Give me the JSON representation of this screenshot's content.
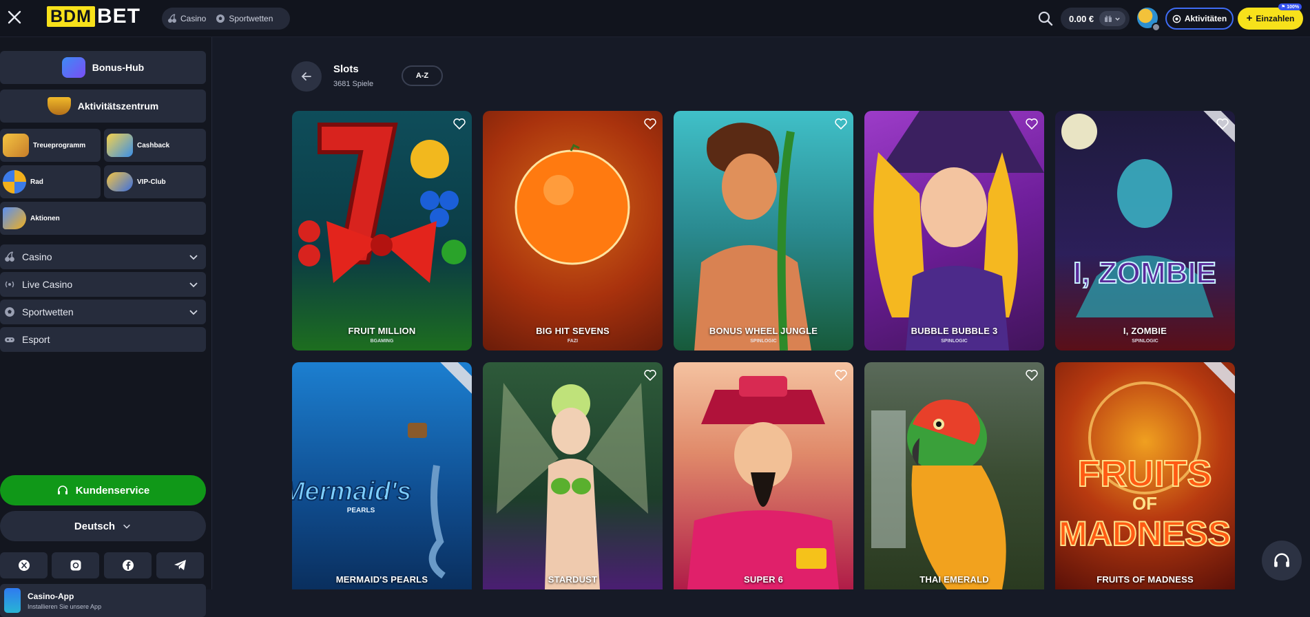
{
  "header": {
    "logo_left": "BDM",
    "logo_right": "BET",
    "nav": [
      {
        "label": "Casino",
        "icon": "casino-icon"
      },
      {
        "label": "Sportwetten",
        "icon": "soccer-ball-icon"
      }
    ],
    "balance": "0.00 €",
    "activities_label": "Aktivitäten",
    "deposit_label": "Einzahlen",
    "deposit_badge": "100%"
  },
  "sidebar": {
    "bonus_hub": "Bonus-Hub",
    "activity_center": "Aktivitätszentrum",
    "grid": [
      {
        "label": "Treueprogramm",
        "icon": "treasure-chest-icon"
      },
      {
        "label": "Cashback",
        "icon": "coin-stack-icon"
      },
      {
        "label": "Rad",
        "icon": "wheel-icon"
      },
      {
        "label": "VIP-Club",
        "icon": "vip-icon"
      },
      {
        "label": "Aktionen",
        "icon": "megaphone-icon"
      }
    ],
    "nav": [
      {
        "label": "Casino",
        "icon": "cherries-icon",
        "expandable": true
      },
      {
        "label": "Live Casino",
        "icon": "broadcast-icon",
        "expandable": true
      },
      {
        "label": "Sportwetten",
        "icon": "soccer-ball-icon",
        "expandable": true
      },
      {
        "label": "Esport",
        "icon": "gamepad-icon",
        "expandable": false
      }
    ],
    "support": "Kundenservice",
    "language": "Deutsch",
    "socials": [
      "x-icon",
      "instagram-icon",
      "facebook-icon",
      "telegram-icon"
    ],
    "app": {
      "title": "Casino-App",
      "subtitle": "Installieren Sie unsere App"
    }
  },
  "page": {
    "title": "Slots",
    "count": "3681 Spiele",
    "sort_label": "A-Z"
  },
  "games": [
    {
      "name": "FRUIT MILLION",
      "provider": "BGAMING"
    },
    {
      "name": "BIG HIT SEVENS",
      "provider": "FAZI"
    },
    {
      "name": "BONUS WHEEL JUNGLE",
      "provider": "SPINLOGIC"
    },
    {
      "name": "BUBBLE BUBBLE 3",
      "provider": "SPINLOGIC"
    },
    {
      "name": "I, ZOMBIE",
      "provider": "SPINLOGIC"
    },
    {
      "name": "MERMAID'S PEARLS",
      "provider": ""
    },
    {
      "name": "STARDUST",
      "provider": ""
    },
    {
      "name": "SUPER 6",
      "provider": ""
    },
    {
      "name": "THAI EMERALD",
      "provider": ""
    },
    {
      "name": "FRUITS OF MADNESS",
      "provider": ""
    }
  ],
  "art_text": {
    "izombie_logo": "I, ZOMBIE",
    "mermaid_logo": "Mermaid's",
    "mermaid_sub": "PEARLS",
    "fruits_logo_1": "FRUITS",
    "fruits_logo_2": "OF",
    "fruits_logo_3": "MADNESS"
  }
}
